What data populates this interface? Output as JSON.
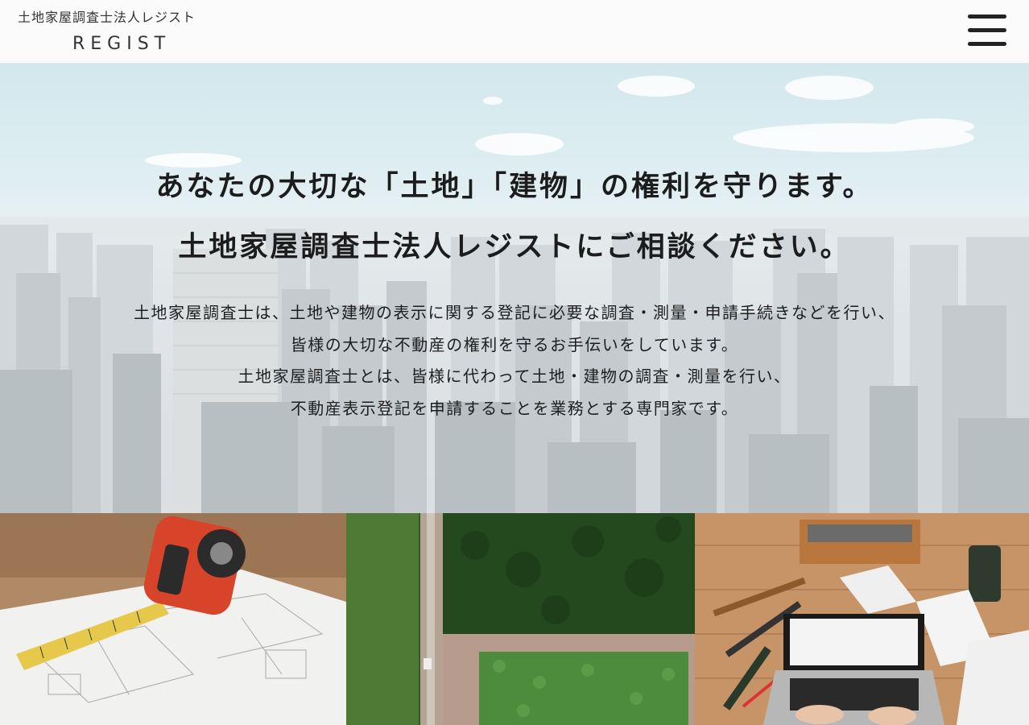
{
  "header": {
    "logo_jp": "土地家屋調査士法人レジスト",
    "logo_en": "REGIST",
    "menu_icon": "hamburger-menu-icon"
  },
  "hero": {
    "headline": [
      "あなたの大切な「土地」「建物」の権利を守ります。",
      "土地家屋調査士法人レジストにご相談ください。"
    ],
    "description": [
      "土地家屋調査士は、土地や建物の表示に関する登記に必要な調査・測量・申請手続きなどを行い、",
      "皆様の大切な不動産の権利を守るお手伝いをしています。",
      "土地家屋調査士とは、皆様に代わって土地・建物の調査・測量を行い、",
      "不動産表示登記を申請することを業務とする専門家です。"
    ]
  },
  "photos": [
    {
      "subject": "tape-measure-on-floor-plan"
    },
    {
      "subject": "aerial-view-of-land-plot"
    },
    {
      "subject": "tools-and-laptop-on-workbench"
    }
  ]
}
